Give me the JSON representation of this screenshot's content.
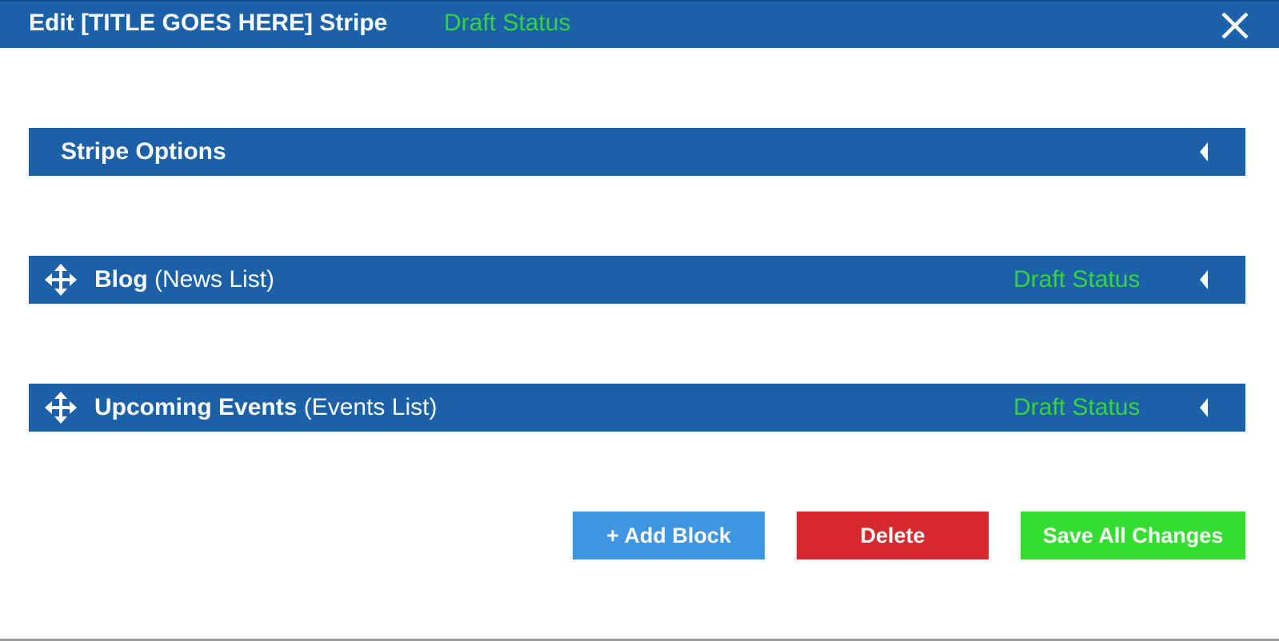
{
  "header": {
    "title": "Edit [TITLE GOES HERE] Stripe",
    "status": "Draft Status",
    "close_icon": "close-icon"
  },
  "sections": {
    "stripe_options": {
      "title": "Stripe Options",
      "caret_icon": "caret-left-icon"
    },
    "blog": {
      "name": "Blog",
      "type": "(News List)",
      "status": "Draft Status",
      "drag_icon": "move-icon",
      "caret_icon": "caret-left-icon"
    },
    "events": {
      "name": "Upcoming Events",
      "type": "(Events List)",
      "status": "Draft Status",
      "drag_icon": "move-icon",
      "caret_icon": "caret-left-icon"
    }
  },
  "actions": {
    "add_block": "+ Add Block",
    "delete": "Delete",
    "save_all": "Save All Changes"
  },
  "colors": {
    "primary": "#1a61a9",
    "status_green": "#35d43a",
    "add_blue": "#3f95e0",
    "delete_red": "#d6292e",
    "save_green": "#34dd30"
  }
}
